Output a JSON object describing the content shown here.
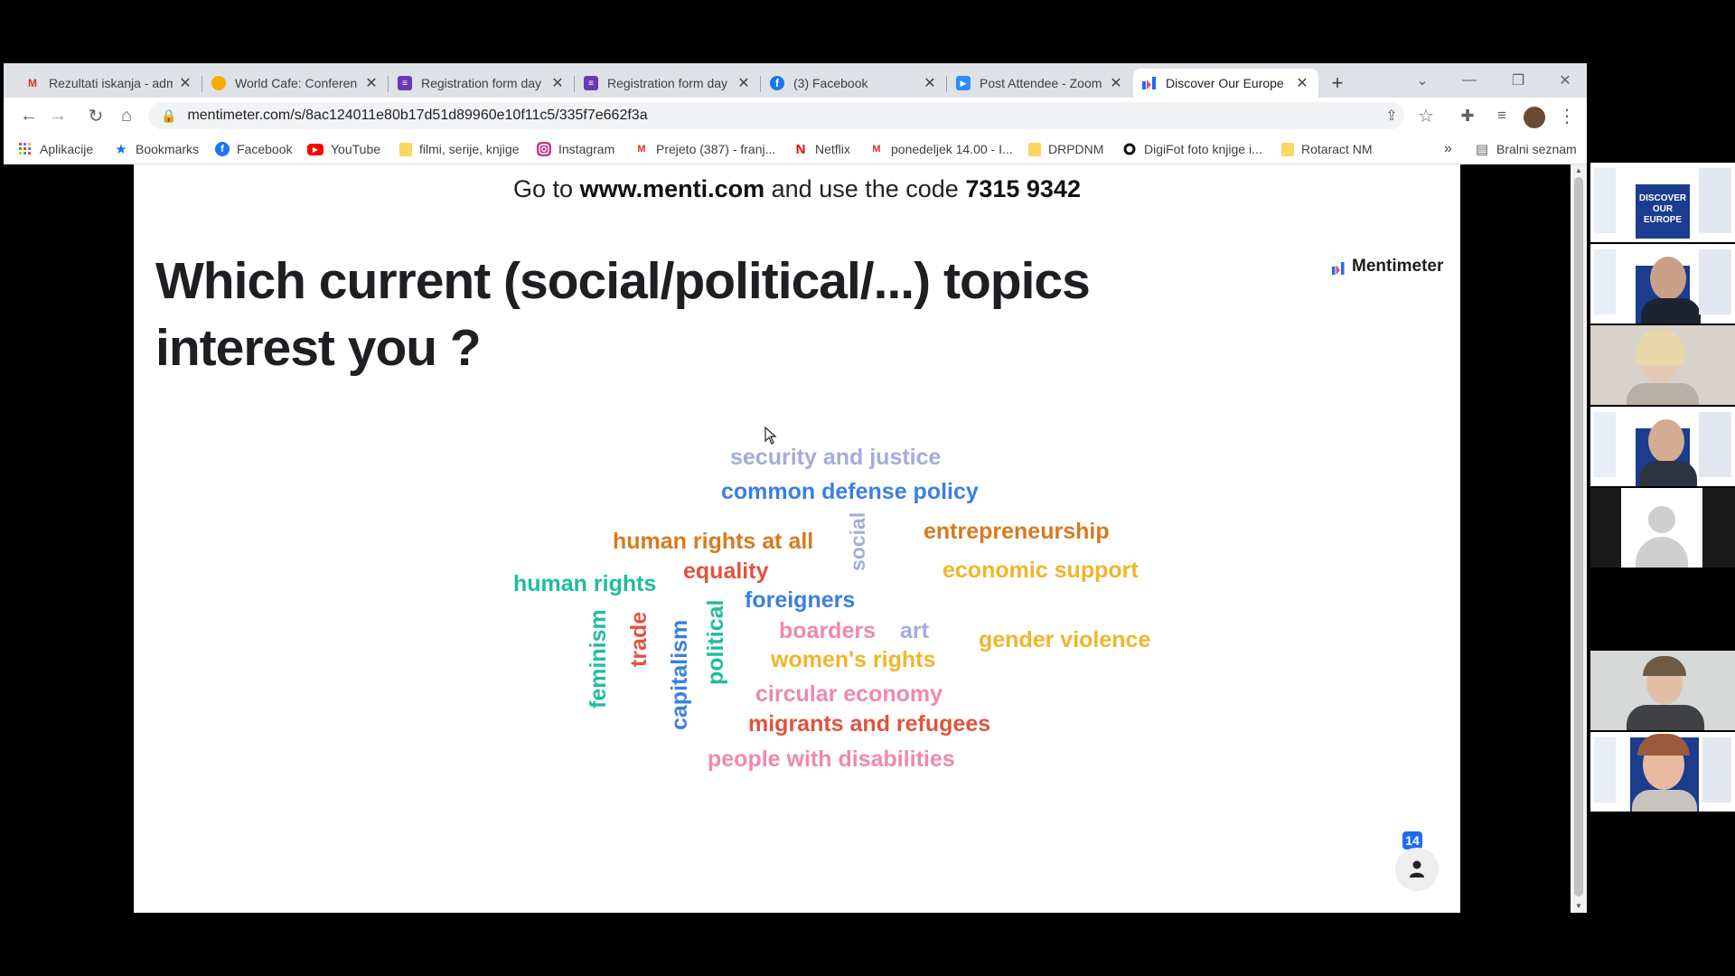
{
  "browser": {
    "tabs": [
      {
        "label": "Rezultati iskanja - adm",
        "favicon": "gmail-icon",
        "color": "#d93025",
        "active": false
      },
      {
        "label": "World Cafe: Conferen",
        "favicon": "world-cafe-icon",
        "color": "#f9ab00",
        "active": false
      },
      {
        "label": "Registration form day",
        "favicon": "google-forms-icon",
        "color": "#673ab7",
        "active": false
      },
      {
        "label": "Registration form day",
        "favicon": "google-forms-icon",
        "color": "#673ab7",
        "active": false
      },
      {
        "label": "(3) Facebook",
        "favicon": "facebook-icon",
        "color": "#1877f2",
        "active": false
      },
      {
        "label": "Post Attendee - Zoom",
        "favicon": "zoom-icon",
        "color": "#2d8cff",
        "active": false
      },
      {
        "label": "Discover Our Europe",
        "favicon": "mentimeter-icon",
        "color": "#1b6ef3",
        "active": true
      }
    ],
    "new_tab_symbol": "+",
    "address": "mentimeter.com/s/8ac124011e80b17d51d89960e10f11c5/335f7e662f3a",
    "bookmarks": [
      {
        "label": "Aplikacije",
        "icon": "apps-grid-icon",
        "color": "#ea4335"
      },
      {
        "label": "Bookmarks",
        "icon": "star-icon",
        "color": "#1a73e8"
      },
      {
        "label": "Facebook",
        "icon": "facebook-icon",
        "color": "#1877f2"
      },
      {
        "label": "YouTube",
        "icon": "youtube-icon",
        "color": "#ff0000"
      },
      {
        "label": "filmi, serije, knjige",
        "icon": "folder-icon",
        "color": "#fdd663"
      },
      {
        "label": "Instagram",
        "icon": "instagram-icon",
        "color": "#c13584"
      },
      {
        "label": "Prejeto (387) - franj...",
        "icon": "gmail-icon",
        "color": "#d93025"
      },
      {
        "label": "Netflix",
        "icon": "netflix-icon",
        "color": "#e50914"
      },
      {
        "label": "ponedeljek 14.00 - I...",
        "icon": "gmail-icon",
        "color": "#d93025"
      },
      {
        "label": "DRPDNM",
        "icon": "folder-icon",
        "color": "#fdd663"
      },
      {
        "label": "DigiFot foto knjige i...",
        "icon": "digifot-icon",
        "color": "#111111"
      },
      {
        "label": "Rotaract NM",
        "icon": "folder-icon",
        "color": "#fdd663"
      }
    ],
    "more_bookmarks": "»",
    "reading_list": "Bralni seznam"
  },
  "slide": {
    "code_prefix": "Go to",
    "code_url": "www.menti.com",
    "code_middle": "and use the code",
    "code": "7315 9342",
    "question": "Which current (social/political/...) topics interest you ?",
    "brand": "Mentimeter",
    "participant_count": "14",
    "words": [
      {
        "text": "security and justice",
        "color": "#a3acdd"
      },
      {
        "text": "common defense policy",
        "color": "#3b7fe0"
      },
      {
        "text": "human rights at all",
        "color": "#d77a1f"
      },
      {
        "text": "social",
        "color": "#a3acdd"
      },
      {
        "text": "entrepreneurship",
        "color": "#d77a1f"
      },
      {
        "text": "equality",
        "color": "#e0533f"
      },
      {
        "text": "economic support",
        "color": "#f0b52a"
      },
      {
        "text": "human rights",
        "color": "#1fbd9c"
      },
      {
        "text": "foreigners",
        "color": "#3b7fe0"
      },
      {
        "text": "feminism",
        "color": "#1fbd9c"
      },
      {
        "text": "trade",
        "color": "#e0533f"
      },
      {
        "text": "capitalism",
        "color": "#3b7fe0"
      },
      {
        "text": "political",
        "color": "#1fbd9c"
      },
      {
        "text": "boarders",
        "color": "#ef8aa8"
      },
      {
        "text": "art",
        "color": "#a3acdd"
      },
      {
        "text": "gender violence",
        "color": "#f0b52a"
      },
      {
        "text": "women's rights",
        "color": "#f0b52a"
      },
      {
        "text": "circular economy",
        "color": "#ef8aa8"
      },
      {
        "text": "migrants and refugees",
        "color": "#e0533f"
      },
      {
        "text": "people with disabilities",
        "color": "#ef8aa8"
      }
    ]
  },
  "gallery": {
    "poster_title": "DISCOVER OUR EUROPE"
  }
}
